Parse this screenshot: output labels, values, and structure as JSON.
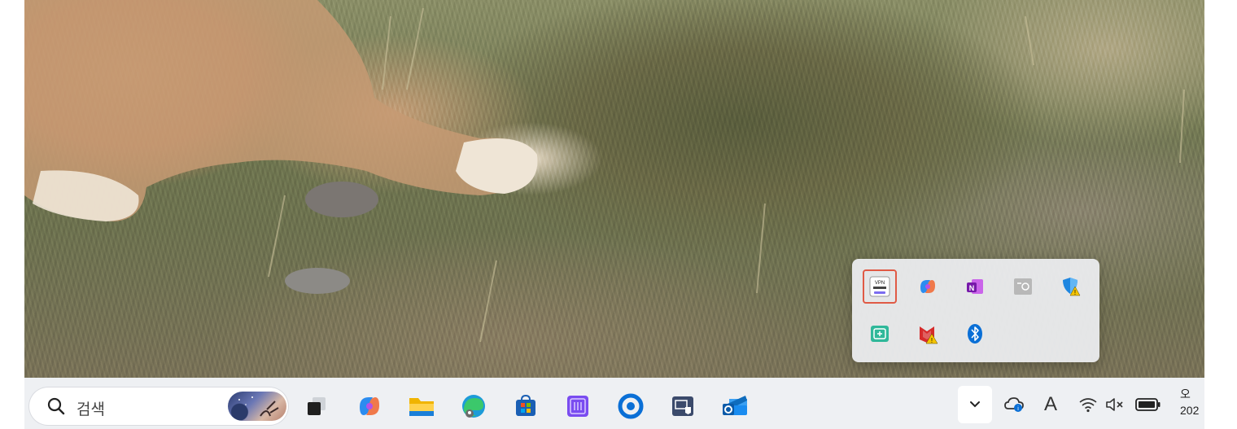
{
  "taskbar": {
    "search": {
      "text": "검색"
    },
    "apps": [
      {
        "name": "task-view-icon"
      },
      {
        "name": "copilot-icon"
      },
      {
        "name": "file-explorer-icon"
      },
      {
        "name": "edge-icon"
      },
      {
        "name": "microsoft-store-icon"
      },
      {
        "name": "purple-app-icon"
      },
      {
        "name": "cortana-ring-icon"
      },
      {
        "name": "remote-desktop-icon"
      },
      {
        "name": "outlook-icon"
      }
    ],
    "tray": {
      "ime": "A",
      "clock_line1": "오",
      "clock_line2": "202"
    }
  },
  "tray_flyout": {
    "icons": [
      {
        "name": "vpn-app-icon",
        "label": "VPN",
        "selected": true
      },
      {
        "name": "copilot-tray-icon"
      },
      {
        "name": "onenote-icon"
      },
      {
        "name": "device-tray-icon"
      },
      {
        "name": "defender-warning-icon"
      },
      {
        "name": "security-tray-icon"
      },
      {
        "name": "mcafee-warning-icon"
      },
      {
        "name": "bluetooth-icon"
      }
    ]
  },
  "colors": {
    "taskbar_bg": "#eef0f3",
    "flyout_bg": "#ecedf0",
    "selection_border": "#e05a45",
    "accent_blue": "#0a6fd6"
  }
}
